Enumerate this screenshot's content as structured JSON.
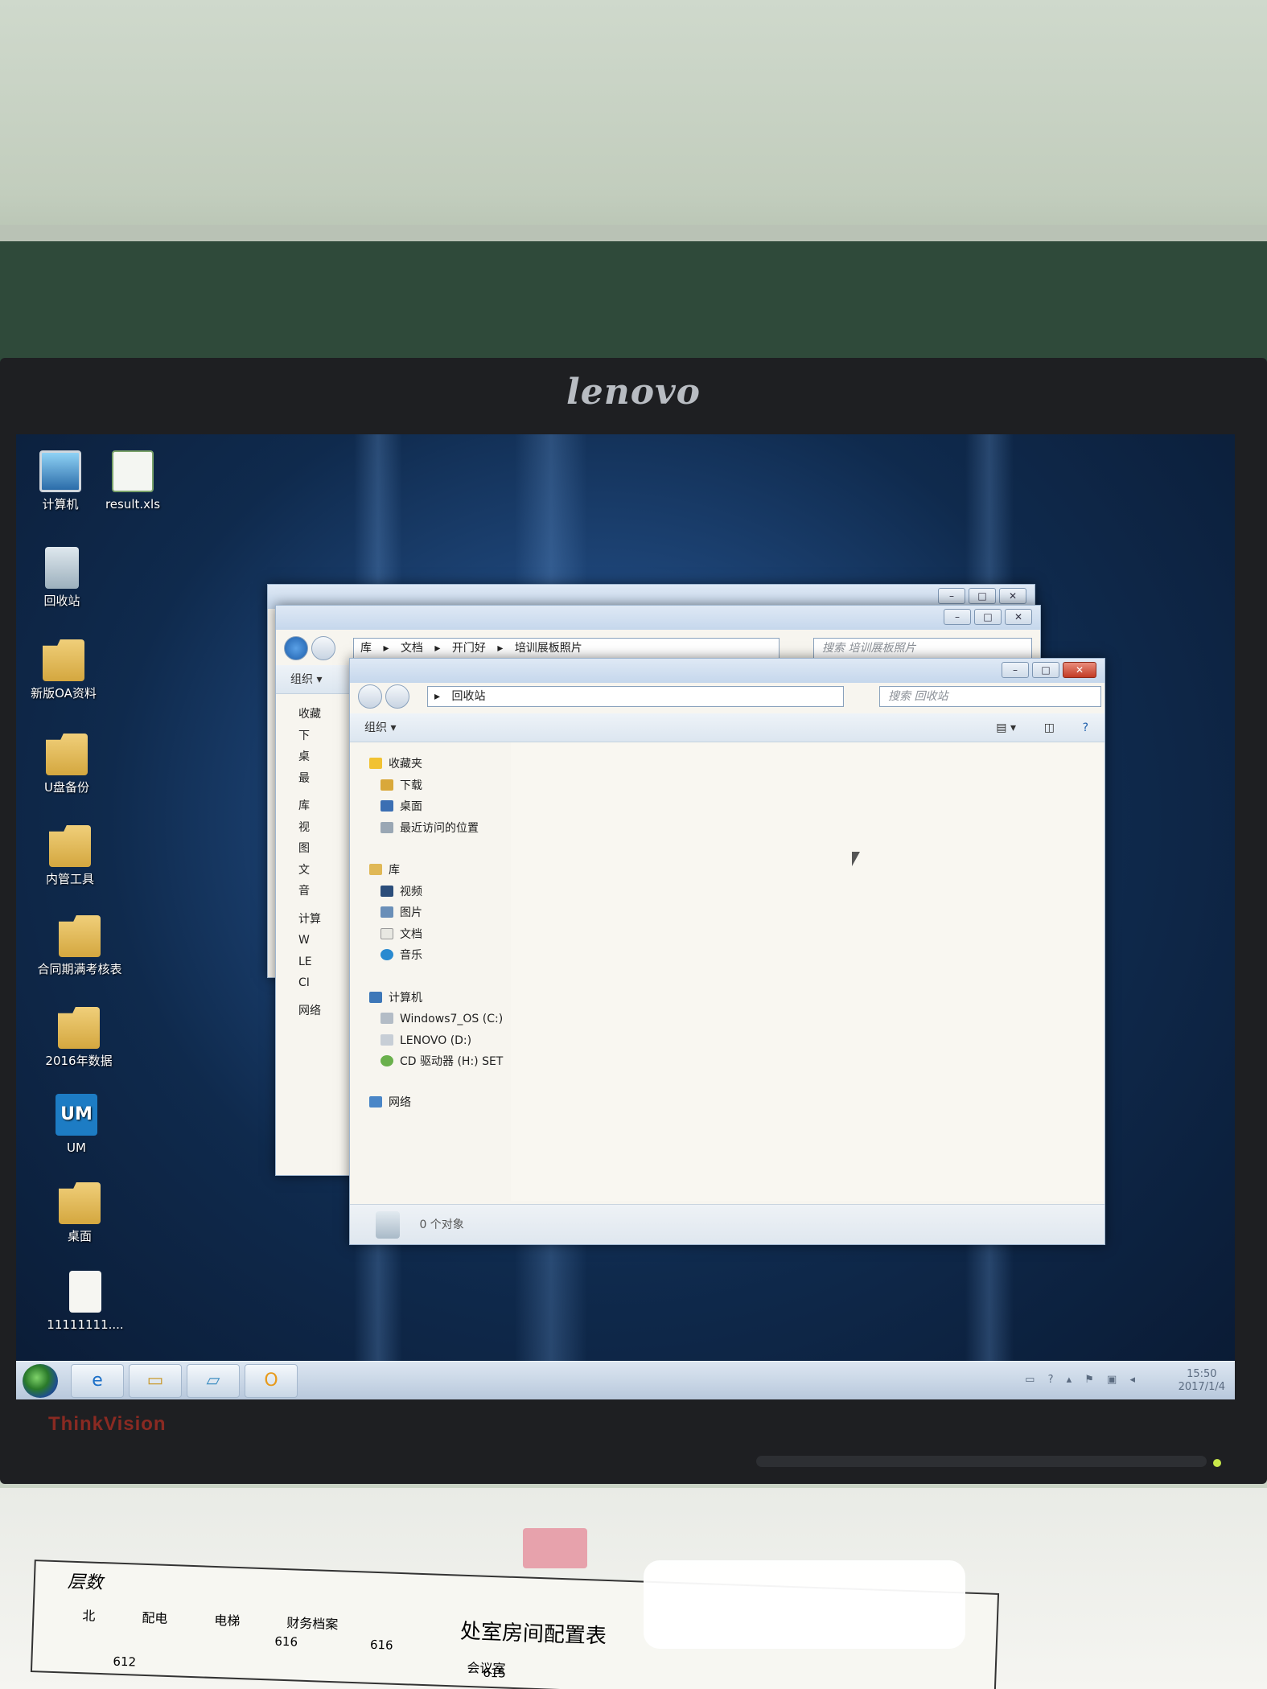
{
  "monitor": {
    "brand": "lenovo",
    "model": "ThinkVision"
  },
  "desktop": {
    "icons": [
      {
        "label": "计算机",
        "icon": "computer-icon"
      },
      {
        "label": "result.xls",
        "icon": "excel-file-icon"
      },
      {
        "label": "回收站",
        "icon": "recycle-bin-icon"
      },
      {
        "label": "新版OA资料",
        "icon": "folder-icon"
      },
      {
        "label": "U盘备份",
        "icon": "folder-icon"
      },
      {
        "label": "内管工具",
        "icon": "folder-icon"
      },
      {
        "label": "合同期满考核表",
        "icon": "folder-icon"
      },
      {
        "label": "2016年数据",
        "icon": "folder-icon"
      },
      {
        "label": "UM",
        "icon": "um-app-icon"
      },
      {
        "label": "桌面",
        "icon": "folder-shortcut-icon"
      },
      {
        "label": "11111111....",
        "icon": "document-icon"
      }
    ]
  },
  "back_window": {
    "breadcrumb": [
      "库",
      "文档",
      "开门好",
      "培训展板照片"
    ],
    "search_placeholder": "搜索 培训展板照片",
    "toolbar_organize": "组织 ▾",
    "tree_partial": [
      "收藏",
      "下",
      "桌",
      "最",
      "库",
      "视",
      "图",
      "文",
      "音",
      "计算",
      "W",
      "LE",
      "CI",
      "网络"
    ]
  },
  "front_window": {
    "breadcrumb": [
      "回收站"
    ],
    "search_placeholder": "搜索 回收站",
    "toolbar_organize": "组织 ▾",
    "nav_tree": {
      "favorites": {
        "label": "收藏夹",
        "items": [
          "下载",
          "桌面",
          "最近访问的位置"
        ]
      },
      "libraries": {
        "label": "库",
        "items": [
          "视频",
          "图片",
          "文档",
          "音乐"
        ]
      },
      "computer": {
        "label": "计算机",
        "items": [
          "Windows7_OS (C:)",
          "LENOVO (D:)",
          "CD 驱动器 (H:) SET"
        ]
      },
      "network": {
        "label": "网络"
      }
    },
    "status_text": "0 个对象"
  },
  "taskbar": {
    "time": "15:50",
    "date": "2017/1/4",
    "apps": [
      "internet-explorer-icon",
      "file-explorer-icon",
      "explorer-windows-icon",
      "outlook-icon"
    ]
  },
  "paper": {
    "title": "处室房间配置表",
    "header": "层数",
    "columns": [
      "北",
      "配电",
      "电梯",
      "财务档案",
      "会议室"
    ],
    "numbers": [
      "616",
      "616",
      "612",
      "615"
    ]
  }
}
